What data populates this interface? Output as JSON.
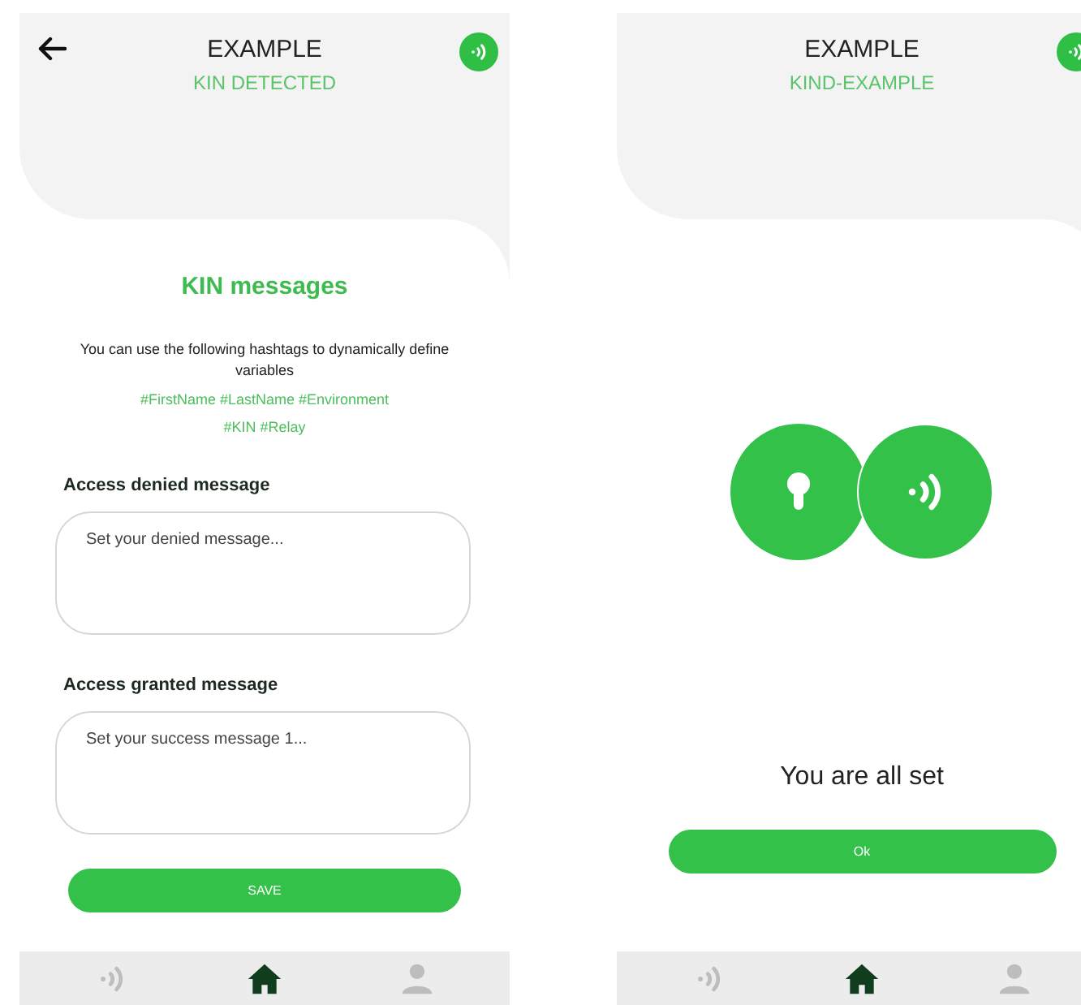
{
  "screens": [
    {
      "kind": "messages",
      "header": {
        "title": "EXAMPLE",
        "subtitle": "KIN DETECTED",
        "back": true
      },
      "heading": "KIN messages",
      "intro": "You can use the following hashtags to dynamically define variables",
      "hashtags": "#FirstName #LastName #Environment #KIN #Relay",
      "fields": [
        {
          "label": "Access denied message",
          "placeholder": "Set your denied message..."
        },
        {
          "label": "Access granted message",
          "placeholder": "Set your success message 1..."
        }
      ],
      "button": "SAVE",
      "nav": [
        {
          "kind": "signal",
          "selected": false
        },
        {
          "kind": "home",
          "selected": true
        },
        {
          "kind": "user",
          "selected": false
        }
      ]
    },
    {
      "kind": "done",
      "header": {
        "title": "EXAMPLE",
        "subtitle": "KIND-EXAMPLE",
        "back": false
      },
      "message": "You are all set",
      "button": "Ok",
      "nav": [
        {
          "kind": "signal",
          "selected": false
        },
        {
          "kind": "home",
          "selected": true
        },
        {
          "kind": "user",
          "selected": false
        }
      ]
    }
  ]
}
